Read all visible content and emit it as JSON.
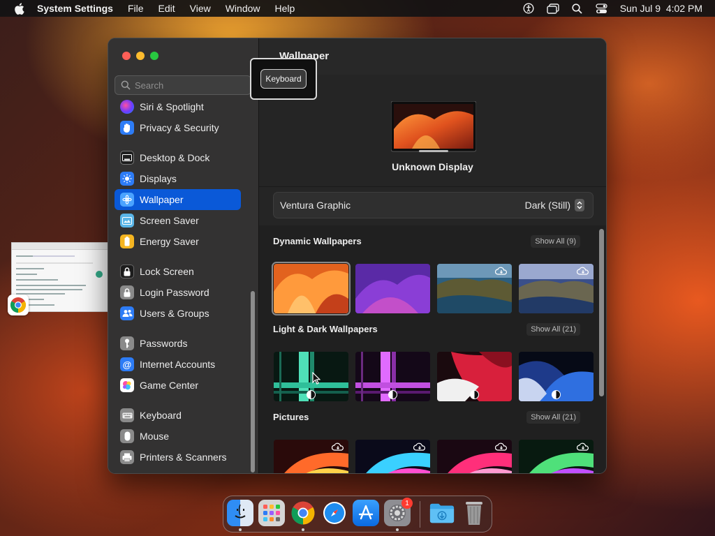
{
  "menubar": {
    "app_name": "System Settings",
    "menus": [
      "File",
      "Edit",
      "View",
      "Window",
      "Help"
    ],
    "status_icons": [
      "accessibility-icon",
      "stage-manager-icon",
      "spotlight-search-icon",
      "control-center-icon"
    ],
    "datetime": "Sun Jul 9  4:02 PM"
  },
  "window": {
    "title": "Wallpaper",
    "search_placeholder": "Search",
    "sidebar": [
      {
        "label": "Siri & Spotlight",
        "icon": "siri-icon"
      },
      {
        "label": "Privacy & Security",
        "icon": "hand-icon"
      },
      {
        "label": "Desktop & Dock",
        "icon": "dock-icon"
      },
      {
        "label": "Displays",
        "icon": "brightness-icon"
      },
      {
        "label": "Wallpaper",
        "icon": "wallpaper-icon",
        "selected": true
      },
      {
        "label": "Screen Saver",
        "icon": "screen-saver-icon"
      },
      {
        "label": "Energy Saver",
        "icon": "battery-icon"
      },
      {
        "label": "Lock Screen",
        "icon": "lock-icon"
      },
      {
        "label": "Login Password",
        "icon": "padlock-icon"
      },
      {
        "label": "Users & Groups",
        "icon": "users-icon"
      },
      {
        "label": "Passwords",
        "icon": "key-icon"
      },
      {
        "label": "Internet Accounts",
        "icon": "at-icon"
      },
      {
        "label": "Game Center",
        "icon": "game-center-icon"
      },
      {
        "label": "Keyboard",
        "icon": "keyboard-icon"
      },
      {
        "label": "Mouse",
        "icon": "mouse-icon"
      },
      {
        "label": "Printers & Scanners",
        "icon": "printer-icon"
      }
    ],
    "display_name": "Unknown Display",
    "current_wallpaper": {
      "name": "Ventura Graphic",
      "appearance": "Dark (Still)"
    },
    "sections": [
      {
        "title": "Dynamic Wallpapers",
        "show_all": "Show All (9)"
      },
      {
        "title": "Light & Dark Wallpapers",
        "show_all": "Show All (21)"
      },
      {
        "title": "Pictures",
        "show_all": "Show All (21)"
      }
    ]
  },
  "tooltip": {
    "label": "Keyboard"
  },
  "dock": {
    "apps": [
      "Finder",
      "Launchpad",
      "Google Chrome",
      "Safari",
      "App Store",
      "System Settings",
      "Downloads",
      "Trash"
    ],
    "settings_badge": "1"
  },
  "colors": {
    "accent": "#0a59d8",
    "sidebar_bg": "#333232",
    "content_bg": "#252525"
  }
}
